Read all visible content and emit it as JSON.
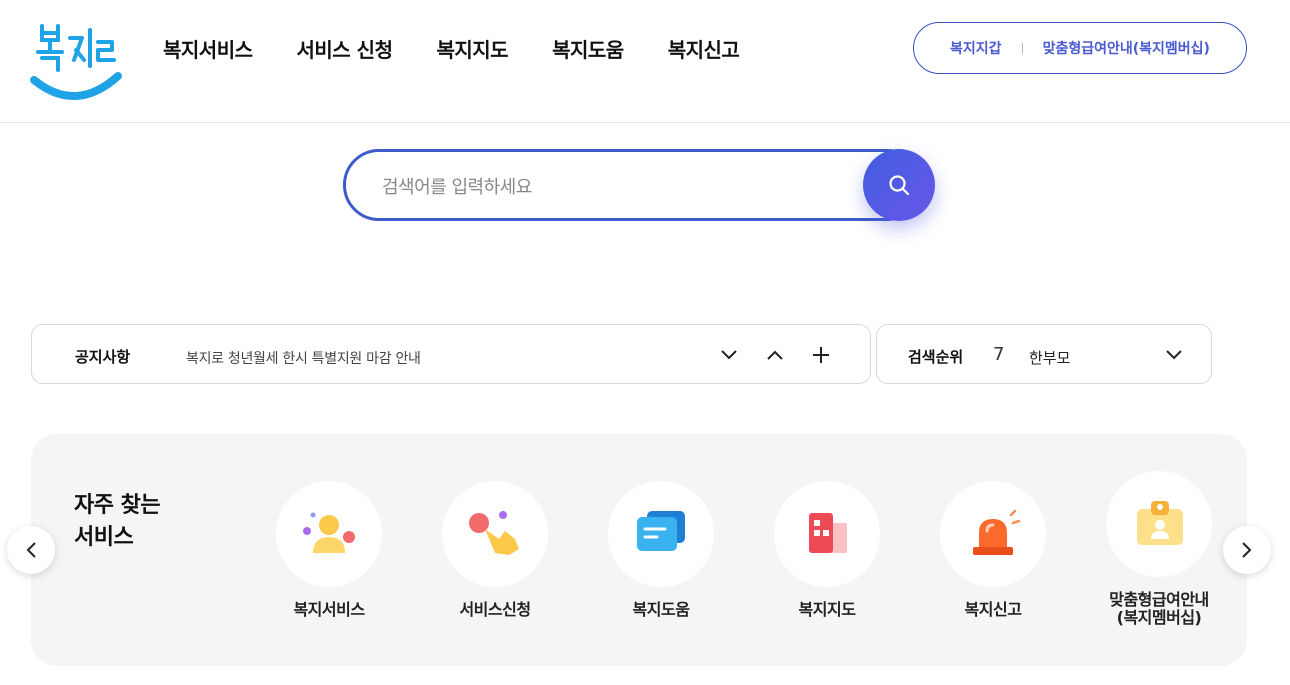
{
  "header": {
    "logo_alt": "복지로",
    "nav": [
      "복지서비스",
      "서비스 신청",
      "복지지도",
      "복지도움",
      "복지신고"
    ],
    "util_links": [
      "복지지갑",
      "맞춤형급여안내(복지멤버십)"
    ]
  },
  "search": {
    "placeholder": "검색어를 입력하세요",
    "value": ""
  },
  "notice": {
    "label": "공지사항",
    "text": "복지로 청년월세 한시 특별지원 마감 안내"
  },
  "rank": {
    "label": "검색순위",
    "number": "7",
    "keyword": "한부모"
  },
  "frequent": {
    "title_line1": "자주 찾는",
    "title_line2": "서비스",
    "items": [
      {
        "label": "복지서비스",
        "icon": "person-icon"
      },
      {
        "label": "서비스신청",
        "icon": "hand-click-icon"
      },
      {
        "label": "복지도움",
        "icon": "chat-icon"
      },
      {
        "label": "복지지도",
        "icon": "building-icon"
      },
      {
        "label": "복지신고",
        "icon": "siren-icon"
      },
      {
        "label": "맞춤형급여안내\n(복지멤버십)",
        "icon": "id-card-icon"
      }
    ]
  },
  "colors": {
    "brand_blue": "#3d5bcb",
    "brand_purple": "#6a56e8",
    "logo_cyan": "#1ea4e6"
  }
}
